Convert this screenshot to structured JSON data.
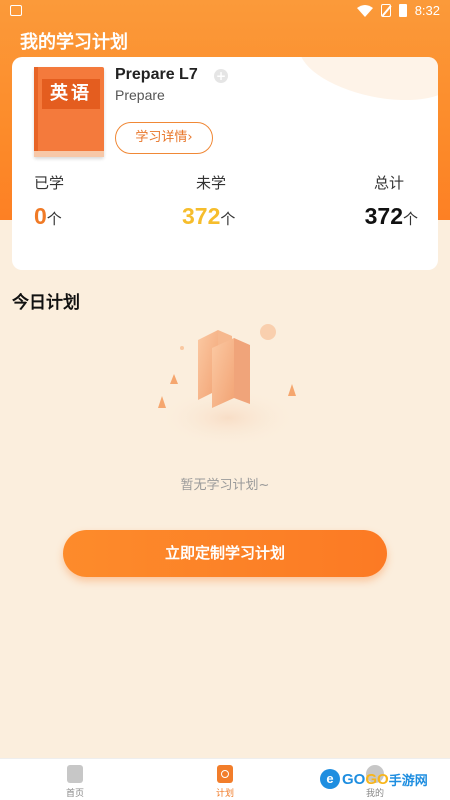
{
  "status_bar": {
    "time": "8:32"
  },
  "header": {
    "title": "我的学习计划"
  },
  "current_book": {
    "cover_label": "英语",
    "title": "Prepare L7",
    "subtitle": "Prepare",
    "details_button": "学习详情›"
  },
  "stats": {
    "learned": {
      "label": "已学",
      "value": "0",
      "unit": "个"
    },
    "unlearned": {
      "label": "未学",
      "value": "372",
      "unit": "个"
    },
    "total": {
      "label": "总计",
      "value": "372",
      "unit": "个"
    }
  },
  "today": {
    "title": "今日计划",
    "empty_text": "暂无学习计划~",
    "cta_button": "立即定制学习计划"
  },
  "bottom_nav": {
    "items": [
      {
        "label": "首页"
      },
      {
        "label": "计划"
      },
      {
        "label": "我的"
      }
    ]
  },
  "watermark": {
    "e": "e",
    "go1": "GO",
    "go2": "GO",
    "cn": "手游网"
  },
  "colors": {
    "accent": "#fc8b2a",
    "unlearned": "#f6bd2c",
    "background": "#fbeedd"
  }
}
